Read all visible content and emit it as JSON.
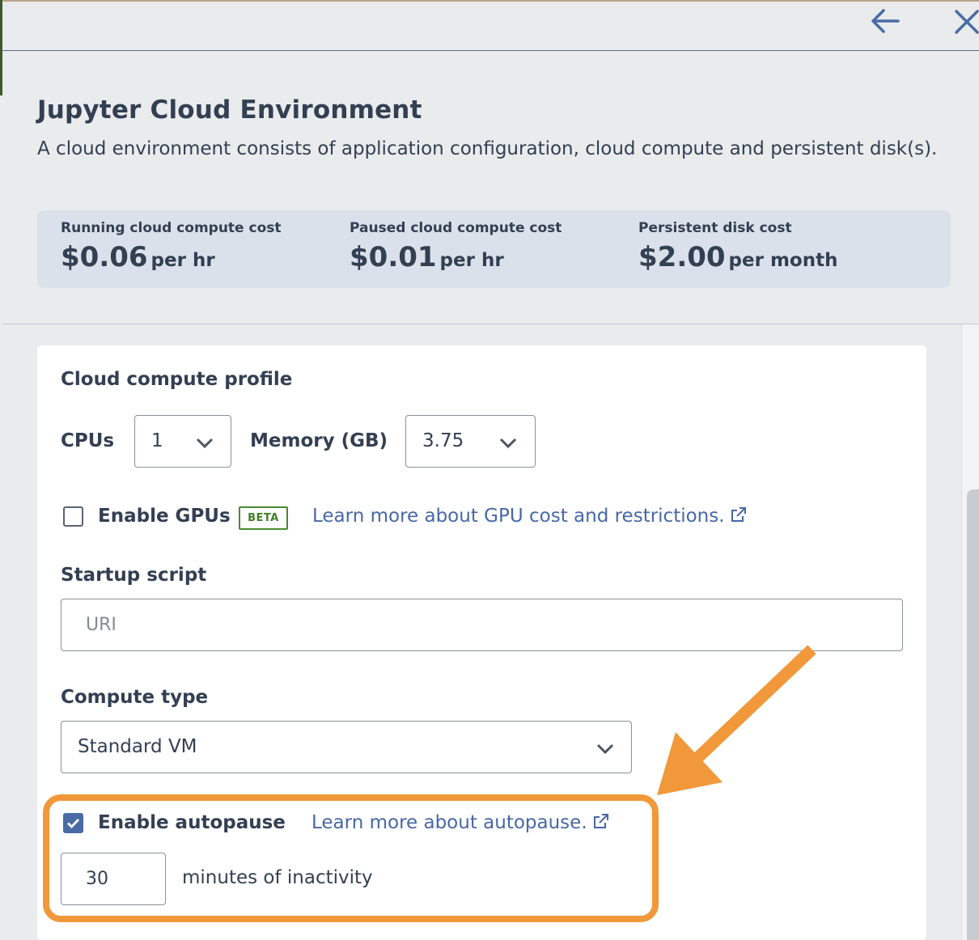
{
  "header": {
    "back_icon": "arrow-left-icon",
    "close_icon": "close-icon"
  },
  "page": {
    "title": "Jupyter Cloud Environment",
    "subtitle": "A cloud environment consists of application configuration, cloud compute and persistent disk(s)."
  },
  "costs": [
    {
      "label": "Running cloud compute cost",
      "amount": "$0.06",
      "unit": "per hr"
    },
    {
      "label": "Paused cloud compute cost",
      "amount": "$0.01",
      "unit": "per hr"
    },
    {
      "label": "Persistent disk cost",
      "amount": "$2.00",
      "unit": "per month"
    }
  ],
  "compute_profile": {
    "heading": "Cloud compute profile",
    "cpus_label": "CPUs",
    "cpus_value": "1",
    "memory_label": "Memory (GB)",
    "memory_value": "3.75"
  },
  "gpus": {
    "checkbox_label": "Enable GPUs",
    "checked": false,
    "badge": "BETA",
    "link": "Learn more about GPU cost and restrictions."
  },
  "startup_script": {
    "label": "Startup script",
    "placeholder": "URI"
  },
  "compute_type": {
    "label": "Compute type",
    "value": "Standard VM"
  },
  "autopause": {
    "checkbox_label": "Enable autopause",
    "checked": true,
    "link": "Learn more about autopause.",
    "minutes_value": "30",
    "minutes_suffix": "minutes of inactivity"
  },
  "annotation": {
    "highlight_color": "#f0983a"
  }
}
